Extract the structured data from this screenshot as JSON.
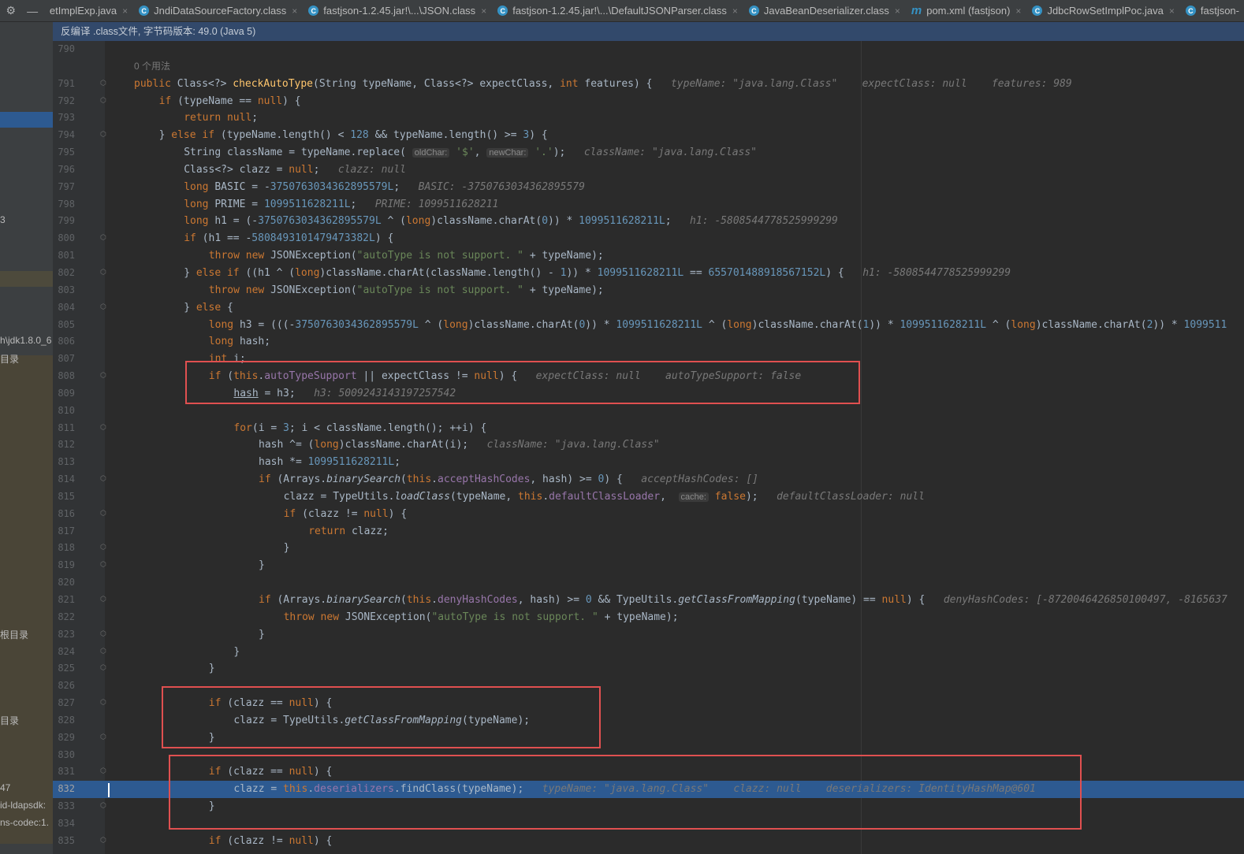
{
  "tabs": [
    {
      "label": "etImplExp.java",
      "icon": "none"
    },
    {
      "label": "JndiDataSourceFactory.class",
      "icon": "class"
    },
    {
      "label": "fastjson-1.2.45.jar!\\...\\JSON.class",
      "icon": "class"
    },
    {
      "label": "fastjson-1.2.45.jar!\\...\\DefaultJSONParser.class",
      "icon": "class"
    },
    {
      "label": "JavaBeanDeserializer.class",
      "icon": "class"
    },
    {
      "label": "pom.xml (fastjson)",
      "icon": "maven"
    },
    {
      "label": "JdbcRowSetImplPoc.java",
      "icon": "class"
    },
    {
      "label": "fastjson-",
      "icon": "class"
    }
  ],
  "info_bar": "反编译 .class文件, 字节码版本: 49.0 (Java 5)",
  "left_panel_fragments": [
    {
      "text": "3",
      "row": 11
    },
    {
      "text": "h\\jdk1.8.0_6",
      "row": 18
    },
    {
      "text": "目录",
      "row": 19
    },
    {
      "text": "根目录",
      "row": 35
    },
    {
      "text": "目录",
      "row": 40
    },
    {
      "text": "47",
      "row": 44
    },
    {
      "text": "id-ldapsdk:",
      "row": 45
    },
    {
      "text": "ns-codec:1.",
      "row": 46
    }
  ],
  "usage_label": "0 个用法",
  "lines": [
    {
      "n": "790",
      "parts": []
    },
    {
      "n": "",
      "parts": [
        [
          "usage",
          "0 个用法"
        ]
      ]
    },
    {
      "n": "791",
      "fold": true,
      "parts": [
        [
          "kw",
          "public "
        ],
        [
          "",
          "Class<?> "
        ],
        [
          "fn",
          "checkAutoType"
        ],
        [
          "",
          "(String typeName, Class<?> expectClass, "
        ],
        [
          "kw",
          "int "
        ],
        [
          "",
          "features) {   "
        ],
        [
          "hint",
          "typeName: \"java.lang.Class\"    expectClass: null    features: 989"
        ]
      ]
    },
    {
      "n": "792",
      "fold": true,
      "d": 1,
      "parts": [
        [
          "kw",
          "if "
        ],
        [
          "",
          "(typeName == "
        ],
        [
          "kw",
          "null"
        ],
        [
          "",
          ") {"
        ]
      ]
    },
    {
      "n": "793",
      "d": 2,
      "parts": [
        [
          "kw",
          "return null"
        ],
        [
          "",
          ";"
        ]
      ]
    },
    {
      "n": "794",
      "fold": true,
      "d": 1,
      "parts": [
        [
          "",
          "} "
        ],
        [
          "kw",
          "else if "
        ],
        [
          "",
          "(typeName.length() < "
        ],
        [
          "num",
          "128 "
        ],
        [
          "",
          "&& typeName.length() >= "
        ],
        [
          "num",
          "3"
        ],
        [
          "",
          ") {"
        ]
      ]
    },
    {
      "n": "795",
      "d": 2,
      "parts": [
        [
          "",
          "String className = typeName.replace( "
        ],
        [
          "ptag",
          "oldChar:"
        ],
        [
          "str",
          " '$'"
        ],
        [
          "",
          ", "
        ],
        [
          "ptag",
          "newChar:"
        ],
        [
          "str",
          " '.'"
        ],
        [
          "",
          ");   "
        ],
        [
          "hint",
          "className: \"java.lang.Class\""
        ]
      ]
    },
    {
      "n": "796",
      "d": 2,
      "parts": [
        [
          "",
          "Class<?> clazz = "
        ],
        [
          "kw",
          "null"
        ],
        [
          "",
          ";   "
        ],
        [
          "hint",
          "clazz: null"
        ]
      ]
    },
    {
      "n": "797",
      "d": 2,
      "parts": [
        [
          "kw",
          "long "
        ],
        [
          "",
          "BASIC = -"
        ],
        [
          "num",
          "3750763034362895579L"
        ],
        [
          "",
          ";   "
        ],
        [
          "hint",
          "BASIC: -3750763034362895579"
        ]
      ]
    },
    {
      "n": "798",
      "d": 2,
      "parts": [
        [
          "kw",
          "long "
        ],
        [
          "",
          "PRIME = "
        ],
        [
          "num",
          "1099511628211L"
        ],
        [
          "",
          ";   "
        ],
        [
          "hint",
          "PRIME: 1099511628211"
        ]
      ]
    },
    {
      "n": "799",
      "d": 2,
      "parts": [
        [
          "kw",
          "long "
        ],
        [
          "",
          "h1 = (-"
        ],
        [
          "num",
          "3750763034362895579L "
        ],
        [
          "",
          "^ ("
        ],
        [
          "kw",
          "long"
        ],
        [
          "",
          ")className.charAt("
        ],
        [
          "num",
          "0"
        ],
        [
          "",
          ")) * "
        ],
        [
          "num",
          "1099511628211L"
        ],
        [
          "",
          ";   "
        ],
        [
          "hint",
          "h1: -5808544778525999299"
        ]
      ]
    },
    {
      "n": "800",
      "fold": true,
      "d": 2,
      "parts": [
        [
          "kw",
          "if "
        ],
        [
          "",
          "(h1 == -"
        ],
        [
          "num",
          "5808493101479473382L"
        ],
        [
          "",
          ") {"
        ]
      ]
    },
    {
      "n": "801",
      "d": 3,
      "parts": [
        [
          "kw",
          "throw new "
        ],
        [
          "",
          "JSONException("
        ],
        [
          "str",
          "\"autoType is not support. \" "
        ],
        [
          "",
          "+ typeName);"
        ]
      ]
    },
    {
      "n": "802",
      "fold": true,
      "d": 2,
      "parts": [
        [
          "",
          "} "
        ],
        [
          "kw",
          "else if "
        ],
        [
          "",
          "((h1 ^ ("
        ],
        [
          "kw",
          "long"
        ],
        [
          "",
          ")className.charAt(className.length() - "
        ],
        [
          "num",
          "1"
        ],
        [
          "",
          ")) * "
        ],
        [
          "num",
          "1099511628211L "
        ],
        [
          "",
          "== "
        ],
        [
          "num",
          "655701488918567152L"
        ],
        [
          "",
          ") {   "
        ],
        [
          "hint",
          "h1: -5808544778525999299"
        ]
      ]
    },
    {
      "n": "803",
      "d": 3,
      "parts": [
        [
          "kw",
          "throw new "
        ],
        [
          "",
          "JSONException("
        ],
        [
          "str",
          "\"autoType is not support. \" "
        ],
        [
          "",
          "+ typeName);"
        ]
      ]
    },
    {
      "n": "804",
      "fold": true,
      "d": 2,
      "parts": [
        [
          "",
          "} "
        ],
        [
          "kw",
          "else "
        ],
        [
          "",
          "{"
        ]
      ]
    },
    {
      "n": "805",
      "d": 3,
      "parts": [
        [
          "kw",
          "long "
        ],
        [
          "",
          "h3 = (((-"
        ],
        [
          "num",
          "3750763034362895579L "
        ],
        [
          "",
          "^ ("
        ],
        [
          "kw",
          "long"
        ],
        [
          "",
          ")className.charAt("
        ],
        [
          "num",
          "0"
        ],
        [
          "",
          ")) * "
        ],
        [
          "num",
          "1099511628211L "
        ],
        [
          "",
          "^ ("
        ],
        [
          "kw",
          "long"
        ],
        [
          "",
          ")className.charAt("
        ],
        [
          "num",
          "1"
        ],
        [
          "",
          ")) * "
        ],
        [
          "num",
          "1099511628211L "
        ],
        [
          "",
          "^ ("
        ],
        [
          "kw",
          "long"
        ],
        [
          "",
          ")className.charAt("
        ],
        [
          "num",
          "2"
        ],
        [
          "",
          ")) * "
        ],
        [
          "num",
          "1099511"
        ]
      ]
    },
    {
      "n": "806",
      "d": 3,
      "parts": [
        [
          "kw",
          "long "
        ],
        [
          "",
          "hash;"
        ]
      ]
    },
    {
      "n": "807",
      "d": 3,
      "parts": [
        [
          "kw",
          "int "
        ],
        [
          "",
          "i;"
        ]
      ]
    },
    {
      "n": "808",
      "fold": true,
      "d": 3,
      "parts": [
        [
          "kw",
          "if "
        ],
        [
          "",
          "("
        ],
        [
          "kw",
          "this"
        ],
        [
          "",
          "."
        ],
        [
          "fld",
          "autoTypeSupport "
        ],
        [
          "",
          "|| expectClass != "
        ],
        [
          "kw",
          "null"
        ],
        [
          "",
          ") {   "
        ],
        [
          "hint",
          "expectClass: null    autoTypeSupport: false"
        ]
      ]
    },
    {
      "n": "809",
      "d": 4,
      "parts": [
        [
          "ul",
          "hash"
        ],
        [
          "",
          " = h3;   "
        ],
        [
          "hint",
          "h3: 5009243143197257542"
        ]
      ]
    },
    {
      "n": "810",
      "parts": []
    },
    {
      "n": "811",
      "fold": true,
      "d": 4,
      "parts": [
        [
          "kw",
          "for"
        ],
        [
          "",
          "(i = "
        ],
        [
          "num",
          "3"
        ],
        [
          "",
          "; i < className.length(); ++i) {"
        ]
      ]
    },
    {
      "n": "812",
      "d": 5,
      "parts": [
        [
          "",
          "hash ^= ("
        ],
        [
          "kw",
          "long"
        ],
        [
          "",
          ")className.charAt(i);   "
        ],
        [
          "hint",
          "className: \"java.lang.Class\""
        ]
      ]
    },
    {
      "n": "813",
      "d": 5,
      "parts": [
        [
          "",
          "hash *= "
        ],
        [
          "num",
          "1099511628211L"
        ],
        [
          "",
          ";"
        ]
      ]
    },
    {
      "n": "814",
      "fold": true,
      "d": 5,
      "parts": [
        [
          "kw",
          "if "
        ],
        [
          "",
          "(Arrays."
        ],
        [
          "it",
          "binarySearch"
        ],
        [
          "",
          "("
        ],
        [
          "kw",
          "this"
        ],
        [
          "",
          "."
        ],
        [
          "fld",
          "acceptHashCodes"
        ],
        [
          "",
          ", hash) >= "
        ],
        [
          "num",
          "0"
        ],
        [
          "",
          ") {   "
        ],
        [
          "hint",
          "acceptHashCodes: []"
        ]
      ]
    },
    {
      "n": "815",
      "d": 6,
      "parts": [
        [
          "",
          "clazz = TypeUtils."
        ],
        [
          "it",
          "loadClass"
        ],
        [
          "",
          "(typeName, "
        ],
        [
          "kw",
          "this"
        ],
        [
          "",
          "."
        ],
        [
          "fld",
          "defaultClassLoader"
        ],
        [
          "",
          ",  "
        ],
        [
          "ptag",
          "cache:"
        ],
        [
          "kw",
          " false"
        ],
        [
          "",
          ");   "
        ],
        [
          "hint",
          "defaultClassLoader: null"
        ]
      ]
    },
    {
      "n": "816",
      "fold": true,
      "d": 6,
      "parts": [
        [
          "kw",
          "if "
        ],
        [
          "",
          "(clazz != "
        ],
        [
          "kw",
          "null"
        ],
        [
          "",
          ") {"
        ]
      ]
    },
    {
      "n": "817",
      "d": 7,
      "parts": [
        [
          "kw",
          "return "
        ],
        [
          "",
          "clazz;"
        ]
      ]
    },
    {
      "n": "818",
      "fold": true,
      "d": 6,
      "parts": [
        [
          "",
          "}"
        ]
      ]
    },
    {
      "n": "819",
      "fold": true,
      "d": 5,
      "parts": [
        [
          "",
          "}"
        ]
      ]
    },
    {
      "n": "820",
      "parts": []
    },
    {
      "n": "821",
      "fold": true,
      "d": 5,
      "parts": [
        [
          "kw",
          "if "
        ],
        [
          "",
          "(Arrays."
        ],
        [
          "it",
          "binarySearch"
        ],
        [
          "",
          "("
        ],
        [
          "kw",
          "this"
        ],
        [
          "",
          "."
        ],
        [
          "fld",
          "denyHashCodes"
        ],
        [
          "",
          ", hash) >= "
        ],
        [
          "num",
          "0 "
        ],
        [
          "",
          "&& TypeUtils."
        ],
        [
          "it",
          "getClassFromMapping"
        ],
        [
          "",
          "(typeName) == "
        ],
        [
          "kw",
          "null"
        ],
        [
          "",
          ") {   "
        ],
        [
          "hint",
          "denyHashCodes: [-8720046426850100497, -8165637"
        ]
      ]
    },
    {
      "n": "822",
      "d": 6,
      "parts": [
        [
          "kw",
          "throw new "
        ],
        [
          "",
          "JSONException("
        ],
        [
          "str",
          "\"autoType is not support. \" "
        ],
        [
          "",
          "+ typeName);"
        ]
      ]
    },
    {
      "n": "823",
      "fold": true,
      "d": 5,
      "parts": [
        [
          "",
          "}"
        ]
      ]
    },
    {
      "n": "824",
      "fold": true,
      "d": 4,
      "parts": [
        [
          "",
          "}"
        ]
      ]
    },
    {
      "n": "825",
      "fold": true,
      "d": 3,
      "parts": [
        [
          "",
          "}"
        ]
      ]
    },
    {
      "n": "826",
      "parts": []
    },
    {
      "n": "827",
      "fold": true,
      "d": 3,
      "parts": [
        [
          "kw",
          "if "
        ],
        [
          "",
          "(clazz == "
        ],
        [
          "kw",
          "null"
        ],
        [
          "",
          ") {"
        ]
      ]
    },
    {
      "n": "828",
      "d": 4,
      "parts": [
        [
          "",
          "clazz = TypeUtils."
        ],
        [
          "it",
          "getClassFromMapping"
        ],
        [
          "",
          "(typeName);"
        ]
      ]
    },
    {
      "n": "829",
      "fold": true,
      "d": 3,
      "parts": [
        [
          "",
          "}"
        ]
      ]
    },
    {
      "n": "830",
      "parts": []
    },
    {
      "n": "831",
      "fold": true,
      "d": 3,
      "parts": [
        [
          "kw",
          "if "
        ],
        [
          "",
          "(clazz == "
        ],
        [
          "kw",
          "null"
        ],
        [
          "",
          ") {"
        ]
      ]
    },
    {
      "n": "832",
      "hit": true,
      "d": 4,
      "parts": [
        [
          "",
          "clazz = "
        ],
        [
          "kw",
          "this"
        ],
        [
          "",
          "."
        ],
        [
          "fld",
          "deserializers"
        ],
        [
          "",
          ".findClass(typeName);   "
        ],
        [
          "hint",
          "typeName: \"java.lang.Class\"    clazz: null    deserializers: IdentityHashMap@601"
        ]
      ]
    },
    {
      "n": "833",
      "fold": true,
      "d": 3,
      "parts": [
        [
          "",
          "}"
        ]
      ]
    },
    {
      "n": "834",
      "parts": []
    },
    {
      "n": "835",
      "fold": true,
      "d": 3,
      "parts": [
        [
          "kw",
          "if "
        ],
        [
          "",
          "(clazz != "
        ],
        [
          "kw",
          "null"
        ],
        [
          "",
          ") {"
        ]
      ]
    }
  ],
  "colors": {
    "background": "#2b2b2b",
    "keyword": "#cc7832",
    "method": "#ffc66d",
    "number": "#6897bb",
    "string": "#6a8759",
    "field": "#9876aa",
    "execution_line": "#2d5a91",
    "annotation_box": "#e05050"
  },
  "icons": [
    "gear-icon",
    "minimize-icon",
    "class-file-icon",
    "maven-icon",
    "close-icon",
    "fold-icon"
  ]
}
